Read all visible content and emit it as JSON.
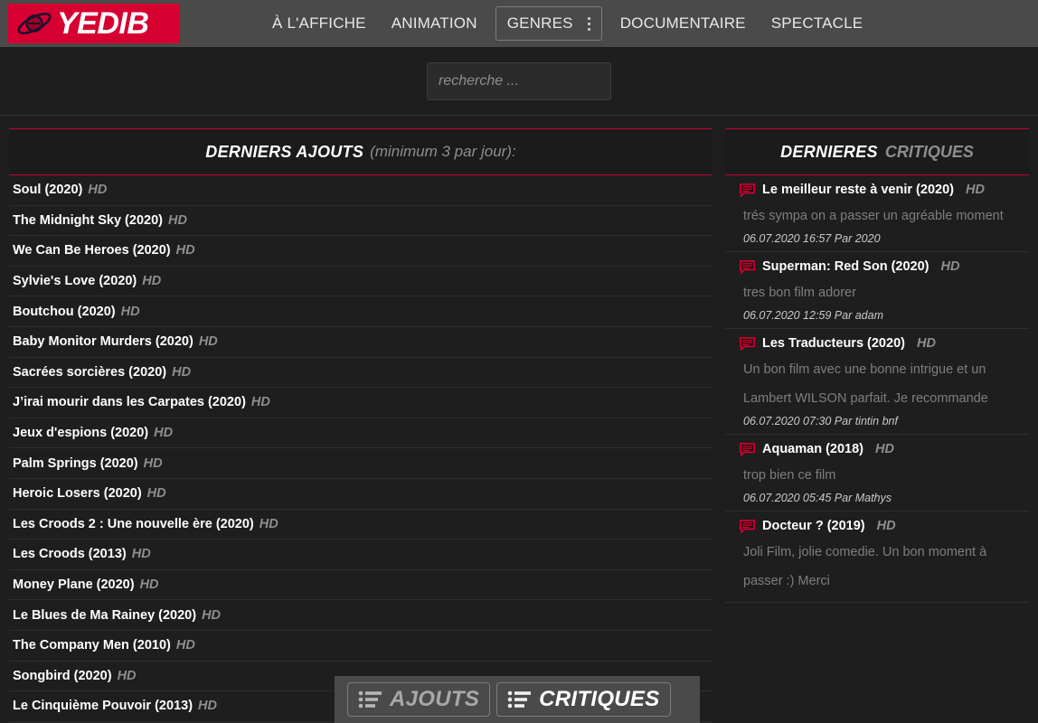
{
  "colors": {
    "brand_red": "#d60031",
    "accent_red": "#c0052f",
    "nav_bg": "#4a4a4a",
    "page_bg": "#1e1e1e",
    "text_primary": "#ffffff",
    "text_muted": "#8e8e8e"
  },
  "header": {
    "logo_icon": "planet-icon",
    "logo_text": "YEDIB",
    "nav": [
      {
        "label": "À L'AFFICHE",
        "boxed": false,
        "kebab": false
      },
      {
        "label": "ANIMATION",
        "boxed": false,
        "kebab": false
      },
      {
        "label": "GENRES",
        "boxed": true,
        "kebab": true,
        "kebab_icon": "kebab-menu-icon"
      },
      {
        "label": "DOCUMENTAIRE",
        "boxed": false,
        "kebab": false
      },
      {
        "label": "SPECTACLE",
        "boxed": false,
        "kebab": false
      }
    ]
  },
  "search": {
    "placeholder": "recherche ...",
    "value": ""
  },
  "ajouts": {
    "title": "DERNIERS AJOUTS",
    "subtitle": "(minimum 3 par jour):",
    "hd_label": "HD",
    "items": [
      {
        "title": "Soul (2020)",
        "quality": "HD"
      },
      {
        "title": "The Midnight Sky (2020)",
        "quality": "HD"
      },
      {
        "title": "We Can Be Heroes (2020)",
        "quality": "HD"
      },
      {
        "title": "Sylvie's Love (2020)",
        "quality": "HD"
      },
      {
        "title": "Boutchou (2020)",
        "quality": "HD"
      },
      {
        "title": "Baby Monitor Murders (2020)",
        "quality": "HD"
      },
      {
        "title": "Sacrées sorcières (2020)",
        "quality": "HD"
      },
      {
        "title": "J’irai mourir dans les Carpates (2020)",
        "quality": "HD"
      },
      {
        "title": "Jeux d'espions (2020)",
        "quality": "HD"
      },
      {
        "title": "Palm Springs (2020)",
        "quality": "HD"
      },
      {
        "title": "Heroic Losers (2020)",
        "quality": "HD"
      },
      {
        "title": "Les Croods 2 : Une nouvelle ère (2020)",
        "quality": "HD"
      },
      {
        "title": "Les Croods (2013)",
        "quality": "HD"
      },
      {
        "title": "Money Plane (2020)",
        "quality": "HD"
      },
      {
        "title": "Le Blues de Ma Rainey (2020)",
        "quality": "HD"
      },
      {
        "title": "The Company Men (2010)",
        "quality": "HD"
      },
      {
        "title": "Songbird (2020)",
        "quality": "HD"
      },
      {
        "title": "Le Cinquième Pouvoir (2013)",
        "quality": "HD"
      }
    ]
  },
  "critiques": {
    "title": "DERNIERES",
    "title2": "CRITIQUES",
    "icon": "comment-bubble-icon",
    "items": [
      {
        "title": "Le meilleur reste à venir (2020)",
        "quality": "HD",
        "body": "trés sympa on a passer un agréable moment",
        "meta": "06.07.2020 16:57 Par 2020"
      },
      {
        "title": "Superman: Red Son (2020)",
        "quality": "HD",
        "body": "tres bon film adorer",
        "meta": "06.07.2020 12:59 Par adam"
      },
      {
        "title": "Les Traducteurs (2020)",
        "quality": "HD",
        "body": "Un bon film avec une bonne intrigue et un Lambert WILSON parfait. Je recommande",
        "meta": "06.07.2020 07:30 Par tintin bnf"
      },
      {
        "title": "Aquaman (2018)",
        "quality": "HD",
        "body": "trop bien ce film",
        "meta": "06.07.2020 05:45 Par Mathys"
      },
      {
        "title": "Docteur ? (2019)",
        "quality": "HD",
        "body": "Joli Film, jolie comedie. Un bon moment à passer :) Merci",
        "meta": ""
      }
    ]
  },
  "floatbar": {
    "buttons": [
      {
        "label": "AJOUTS",
        "icon": "list-icon",
        "active": false
      },
      {
        "label": "CRITIQUES",
        "icon": "list-icon",
        "active": true
      }
    ]
  }
}
